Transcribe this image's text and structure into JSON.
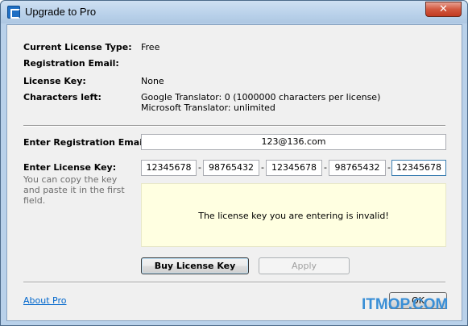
{
  "window": {
    "title": "Upgrade to Pro",
    "close_glyph": "✕"
  },
  "info": {
    "license_type_label": "Current License Type:",
    "license_type_value": "Free",
    "reg_email_label": "Registration Email:",
    "reg_email_value": "",
    "license_key_label": "License Key:",
    "license_key_value": "None",
    "chars_left_label": "Characters left:",
    "chars_left_google": "Google Translator: 0 (1000000 characters per license)",
    "chars_left_microsoft": "Microsoft Translator: unlimited"
  },
  "form": {
    "email_label": "Enter Registration Email:",
    "email_value": "123@136.com",
    "key_label": "Enter License Key:",
    "key_hint": "You can copy the key and paste it in the first field.",
    "key_parts": [
      "12345678",
      "98765432",
      "12345678",
      "98765432",
      "12345678"
    ],
    "dash": "-",
    "message": "The license key you are entering is invalid!"
  },
  "buttons": {
    "buy_label": "Buy License Key",
    "apply_label": "Apply",
    "ok_label": "OK"
  },
  "footer": {
    "about_link": "About Pro"
  },
  "watermark": "ITMOP.COM"
}
